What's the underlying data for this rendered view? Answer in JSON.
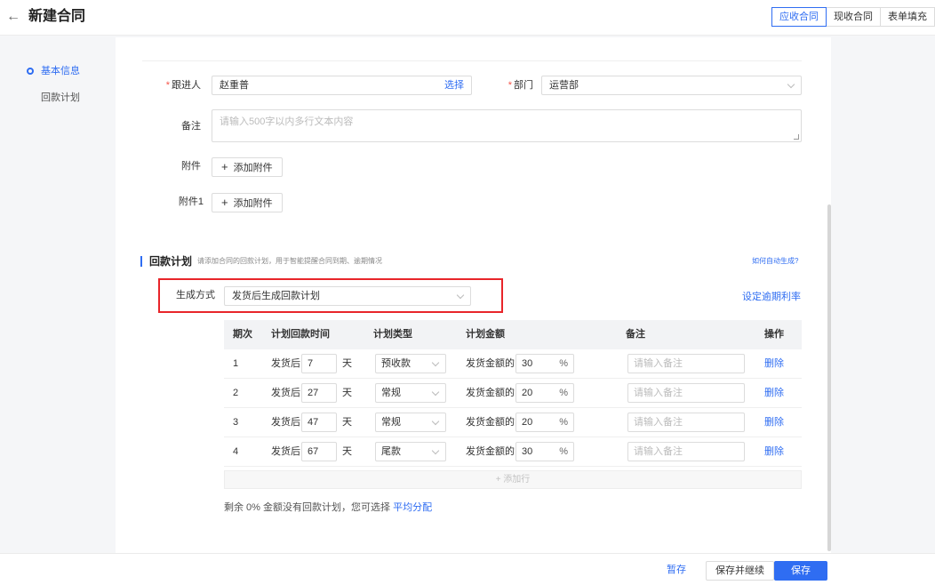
{
  "header": {
    "title": "新建合同",
    "tabs": [
      "应收合同",
      "现收合同",
      "表单填充"
    ]
  },
  "nav": {
    "items": [
      "基本信息",
      "回款计划"
    ]
  },
  "form": {
    "follower": {
      "label": "跟进人",
      "value": "赵重普",
      "action": "选择"
    },
    "department": {
      "label": "部门",
      "value": "运营部"
    },
    "remark": {
      "label": "备注",
      "placeholder": "请输入500字以内多行文本内容"
    },
    "attachment": {
      "label": "附件",
      "button": "添加附件"
    },
    "attachment1": {
      "label": "附件1",
      "button": "添加附件"
    }
  },
  "plan_section": {
    "title": "回款计划",
    "description": "请添加合同的回款计划，用于智能提醒合同到期、逾期情况",
    "help_link": "如何自动生成?",
    "method_label": "生成方式",
    "method_value": "发货后生成回款计划",
    "overdue_link": "设定逾期利率",
    "columns": [
      "期次",
      "计划回款时间",
      "计划类型",
      "计划金额",
      "备注",
      "操作"
    ],
    "rows": [
      {
        "no": "1",
        "prefix": "发货后",
        "days": "7",
        "unit": "天",
        "type": "预收款",
        "amount_label": "发货金额的",
        "percent": "30",
        "percent_sign": "%",
        "note_placeholder": "请输入备注",
        "action": "删除"
      },
      {
        "no": "2",
        "prefix": "发货后",
        "days": "27",
        "unit": "天",
        "type": "常规",
        "amount_label": "发货金额的",
        "percent": "20",
        "percent_sign": "%",
        "note_placeholder": "请输入备注",
        "action": "删除"
      },
      {
        "no": "3",
        "prefix": "发货后",
        "days": "47",
        "unit": "天",
        "type": "常规",
        "amount_label": "发货金额的",
        "percent": "20",
        "percent_sign": "%",
        "note_placeholder": "请输入备注",
        "action": "删除"
      },
      {
        "no": "4",
        "prefix": "发货后",
        "days": "67",
        "unit": "天",
        "type": "尾款",
        "amount_label": "发货金额的",
        "percent": "30",
        "percent_sign": "%",
        "note_placeholder": "请输入备注",
        "action": "删除"
      }
    ],
    "add_row": "+ 添加行",
    "remaining_text": "剩余 0% 金额没有回款计划，您可选择",
    "average_link": "平均分配"
  },
  "footer": {
    "draft": "暂存",
    "save_continue": "保存并继续",
    "save": "保存"
  },
  "colors": {
    "accent": "#2f6df2",
    "required": "#f5554a",
    "highlight": "#e8252a"
  },
  "icons": [
    "back-arrow-icon",
    "chevron-down-icon",
    "plus-icon",
    "resize-handle-icon"
  ]
}
